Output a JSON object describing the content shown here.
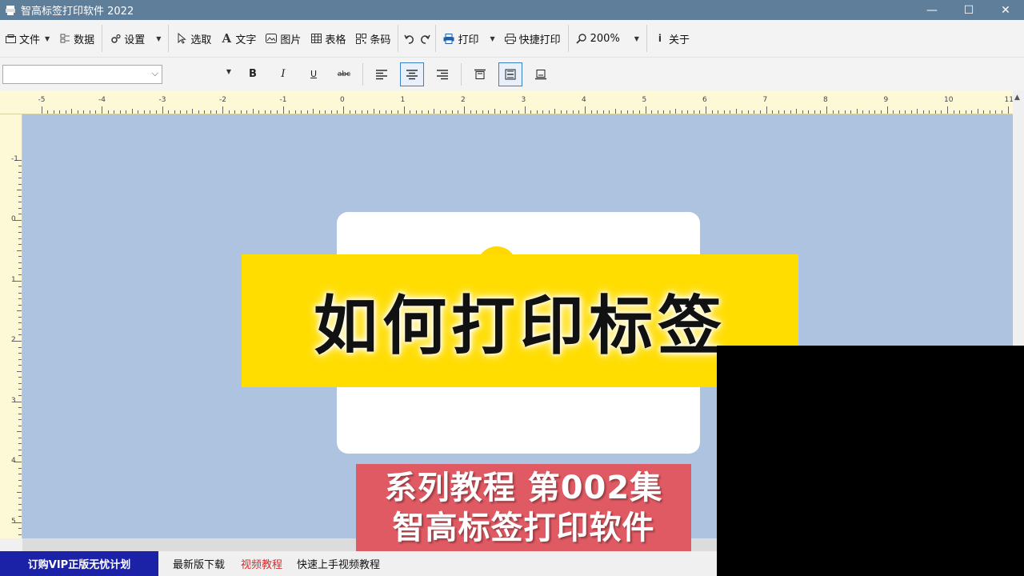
{
  "window": {
    "title": "智高标签打印软件 2022",
    "controls": {
      "minimize": "—",
      "maximize": "☐",
      "close": "✕"
    }
  },
  "toolbar": {
    "file": "文件",
    "data": "数据",
    "settings": "设置",
    "select": "选取",
    "text": "文字",
    "image": "图片",
    "table": "表格",
    "barcode": "条码",
    "print": "打印",
    "quick_print": "快捷打印",
    "zoom": "200%",
    "about": "关于"
  },
  "formatbar": {
    "font_value": "",
    "size_value": "",
    "bold": "B",
    "italic": "I",
    "underline": "U",
    "strike": "abc"
  },
  "ruler": {
    "h_labels": [
      "-5",
      "-4",
      "-3",
      "-2",
      "-1",
      "0",
      "1",
      "2",
      "3",
      "4",
      "5",
      "6",
      "7",
      "8",
      "9",
      "10",
      "11"
    ],
    "v_labels": [
      "-1",
      "0",
      "1",
      "2",
      "3",
      "4",
      "5"
    ]
  },
  "overlay": {
    "headline": "如何打印标签",
    "series_line1": "系列教程 第002集",
    "series_line2": "智高标签打印软件"
  },
  "status": {
    "vip": "订购VIP正版无忧计划",
    "download": "最新版下载",
    "video": "视频教程",
    "quickstart": "快速上手视频教程"
  },
  "colors": {
    "canvas": "#aec3e0",
    "banner_yellow": "#ffdd00",
    "banner_red": "#e05a63",
    "vip": "#1c22a8",
    "titlebar": "#5f7e99"
  }
}
